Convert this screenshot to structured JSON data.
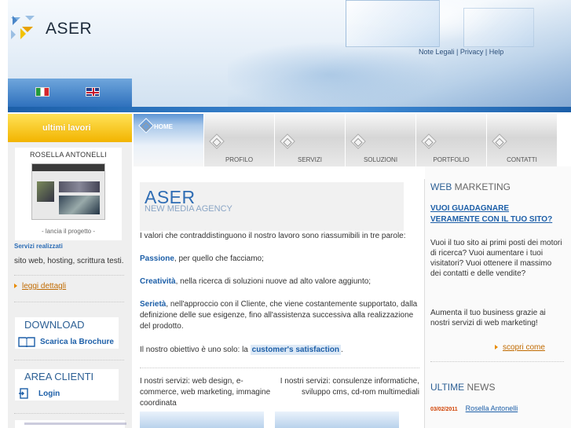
{
  "brand": {
    "name": "ASER"
  },
  "top_links": {
    "legal": "Note Legali",
    "privacy": "Privacy",
    "help": "Help",
    "separator": " | "
  },
  "languages": [
    {
      "code": "it"
    },
    {
      "code": "en"
    }
  ],
  "nav": {
    "items": [
      {
        "label": "HOME",
        "active": true
      },
      {
        "label": "PROFILO"
      },
      {
        "label": "SERVIZI"
      },
      {
        "label": "SOLUZIONI"
      },
      {
        "label": "PORTFOLIO"
      },
      {
        "label": "CONTATTI"
      }
    ]
  },
  "sidebar": {
    "latest_work_label": "ultimi lavori",
    "project": {
      "name": "ROSELLA ANTONELLI",
      "launch": "- lancia il progetto -",
      "services_title": "Servizi realizzati",
      "services": "sito web, hosting, scrittura testi.",
      "details": "leggi dettagli"
    },
    "download": {
      "title": "DOWNLOAD",
      "link": "Scarica la Brochure"
    },
    "area": {
      "title": "AREA CLIENTI",
      "link": "Login"
    }
  },
  "main": {
    "title": "ASER",
    "subtitle": "NEW MEDIA AGENCY",
    "intro": "I valori che contraddistinguono il nostro lavoro sono riassumibili in tre parole:",
    "values": [
      {
        "keyword": "Passione",
        "text": ", per quello che facciamo;"
      },
      {
        "keyword": "Creatività",
        "text": ", nella ricerca di soluzioni nuove ad alto valore aggiunto;"
      },
      {
        "keyword": "Serietà",
        "text": ", nell'approccio con il Cliente, che viene costantemente supportato, dalla definizione delle sue esigenze, fino all'assistenza successiva alla realizzazione del prodotto."
      }
    ],
    "objective_prefix": "Il nostro obiettivo è uno solo: la ",
    "objective_highlight": "customer's satisfaction",
    "objective_suffix": ".",
    "services_left": "I nostri servizi: web design, e-commerce, web marketing, immagine coordinata",
    "services_right": "I nostri servizi: consulenze informatiche, sviluppo cms, cd-rom multimediali"
  },
  "right": {
    "webmarketing_title_a": "WEB",
    "webmarketing_title_b": " MARKETING",
    "question": "VUOI GUADAGNARE VERAMENTE CON IL TUO SITO?",
    "p1": "Vuoi il tuo sito ai primi posti dei motori di ricerca? Vuoi aumentare i tuoi visitatori? Vuoi ottenere il massimo dei contatti e delle vendite?",
    "p2": "Aumenta il tuo business grazie ai nostri servizi di web marketing!",
    "discover": "scopri come",
    "news_title_a": "ULTIME",
    "news_title_b": " NEWS",
    "news": [
      {
        "date": "03/02/2011",
        "title": "Rosella Antonelli"
      }
    ]
  },
  "colors": {
    "accent": "#2f6db4",
    "link": "#1d5fa8",
    "highlight": "#f2b400",
    "orange": "#c06a00"
  }
}
